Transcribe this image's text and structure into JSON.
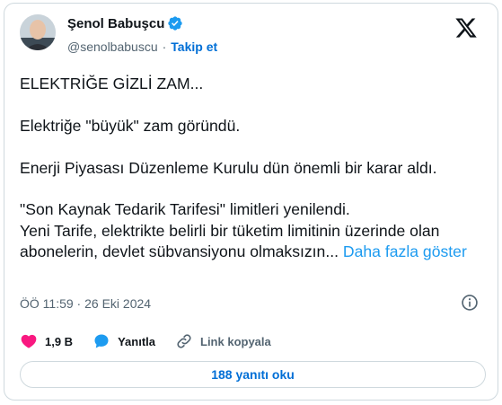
{
  "author": {
    "display_name": "Şenol Babuşcu",
    "handle": "@senolbabuscu",
    "separator": "·",
    "follow_label": "Takip et"
  },
  "tweet": {
    "lines": [
      "ELEKTRİĞE GİZLİ ZAM...",
      "Elektriğe \"büyük\" zam göründü.",
      "Enerji Piyasası Düzenleme Kurulu dün önemli bir karar aldı.",
      "\"Son Kaynak Tedarik Tarifesi\" limitleri yenilendi.",
      "Yeni Tarife, elektrikte belirli bir tüketim limitinin üzerinde olan abonelerin, devlet sübvansiyonu olmaksızın..."
    ],
    "show_more": "Daha fazla göster"
  },
  "meta": {
    "timestamp": "ÖÖ 11:59 · 26 Eki 2024"
  },
  "actions": {
    "likes": "1,9 B",
    "reply_label": "Yanıtla",
    "copy_link_label": "Link kopyala"
  },
  "read_replies_label": "188 yanıtı oku",
  "colors": {
    "accent": "#1d9bf0",
    "link_blue": "#006fd6",
    "like_pink": "#f91880",
    "muted": "#536471",
    "border": "#cfd9de"
  },
  "icons": [
    "verified-badge-icon",
    "x-logo-icon",
    "info-icon",
    "heart-icon",
    "reply-bubble-icon",
    "link-icon"
  ]
}
